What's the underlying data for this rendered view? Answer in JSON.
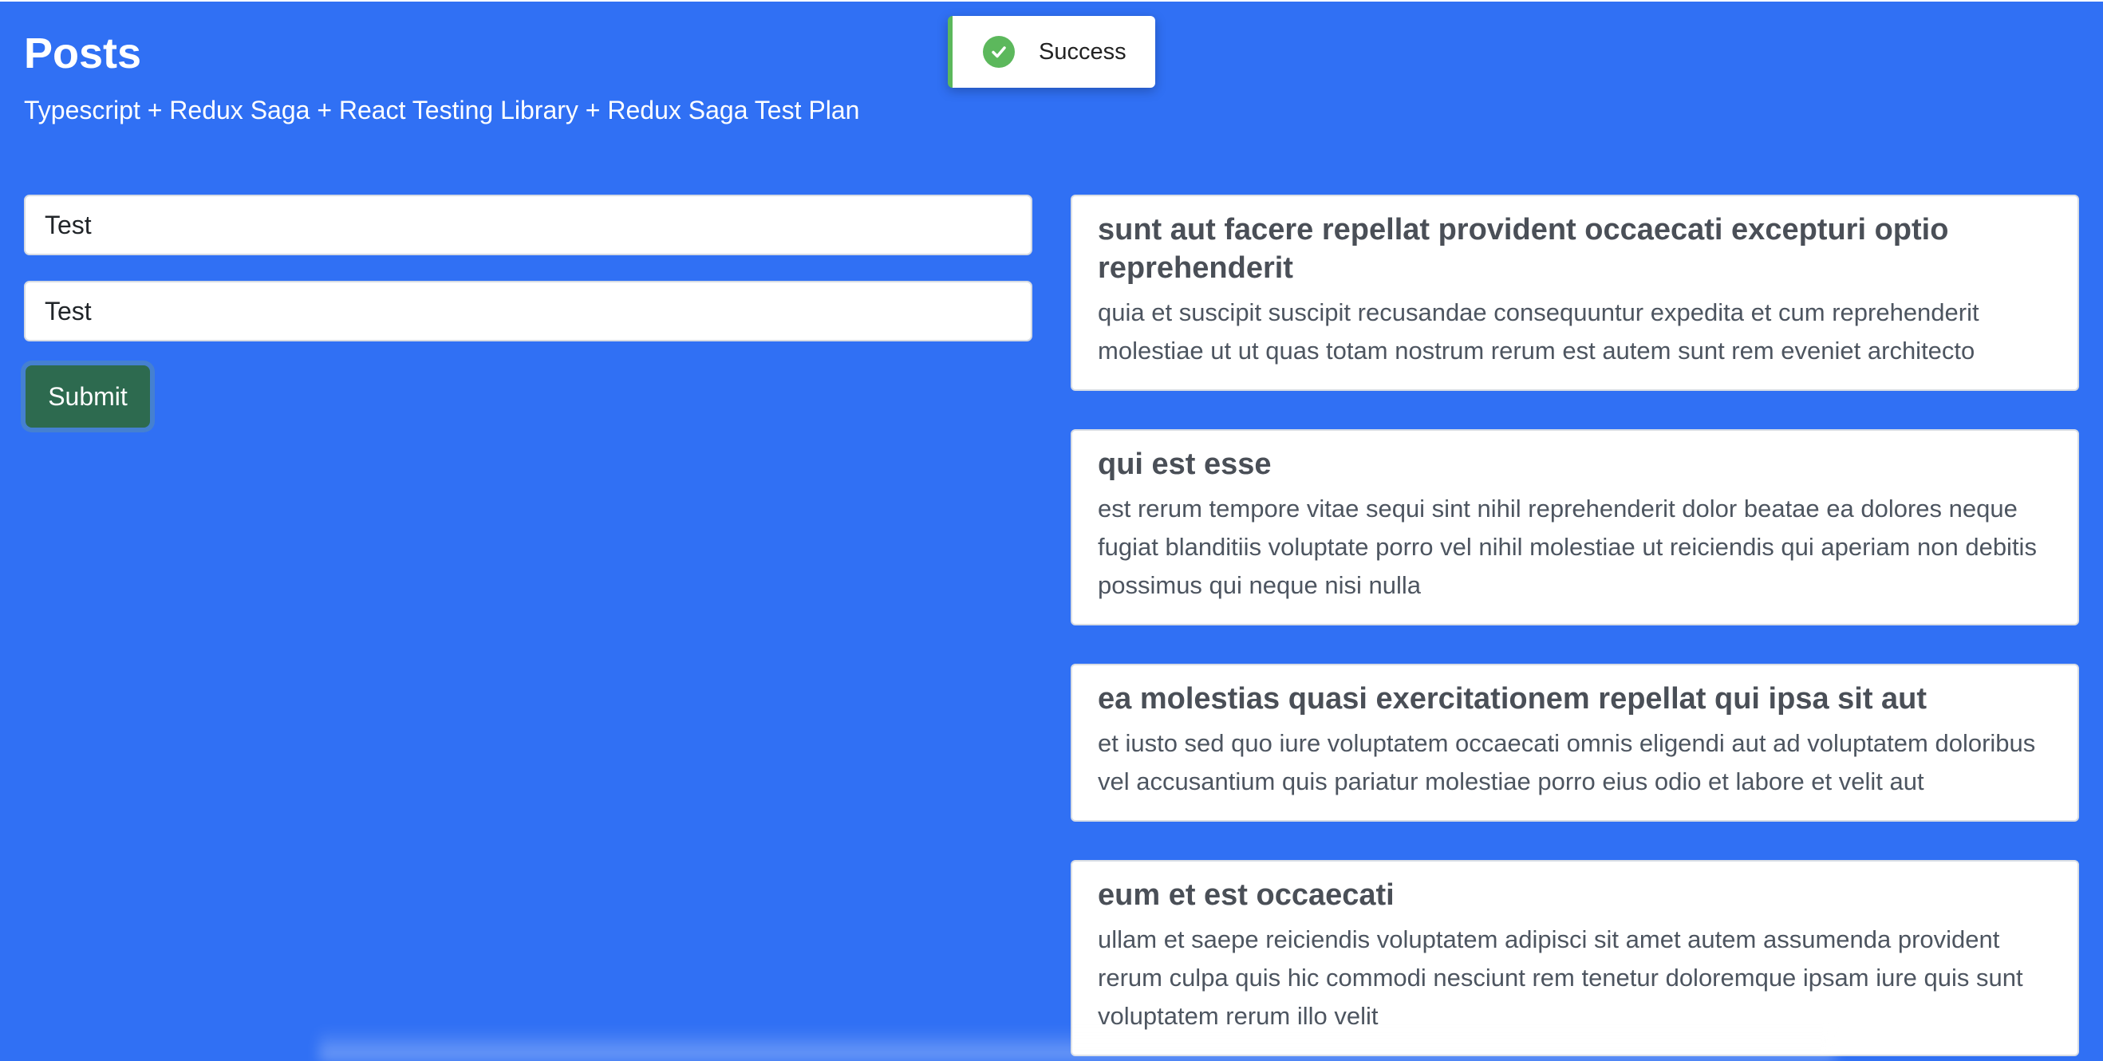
{
  "header": {
    "title": "Posts",
    "subtitle": "Typescript + Redux Saga + React Testing Library + Redux Saga Test Plan"
  },
  "toast": {
    "message": "Success",
    "icon": "check-circle-icon",
    "color": "#5cb85c"
  },
  "form": {
    "title_value": "Test",
    "body_value": "Test",
    "submit_label": "Submit"
  },
  "posts": [
    {
      "title": "sunt aut facere repellat provident occaecati excepturi optio reprehenderit",
      "body": "quia et suscipit suscipit recusandae consequuntur expedita et cum reprehenderit molestiae ut ut quas totam nostrum rerum est autem sunt rem eveniet architecto"
    },
    {
      "title": "qui est esse",
      "body": "est rerum tempore vitae sequi sint nihil reprehenderit dolor beatae ea dolores neque fugiat blanditiis voluptate porro vel nihil molestiae ut reiciendis qui aperiam non debitis possimus qui neque nisi nulla"
    },
    {
      "title": "ea molestias quasi exercitationem repellat qui ipsa sit aut",
      "body": "et iusto sed quo iure voluptatem occaecati omnis eligendi aut ad voluptatem doloribus vel accusantium quis pariatur molestiae porro eius odio et labore et velit aut"
    },
    {
      "title": "eum et est occaecati",
      "body": "ullam et saepe reiciendis voluptatem adipisci sit amet autem assumenda provident rerum culpa quis hic commodi nesciunt rem tenetur doloremque ipsam iure quis sunt voluptatem rerum illo velit"
    }
  ],
  "colors": {
    "background": "#3070f4",
    "submit": "#2d6a4f",
    "success": "#5cb85c"
  }
}
